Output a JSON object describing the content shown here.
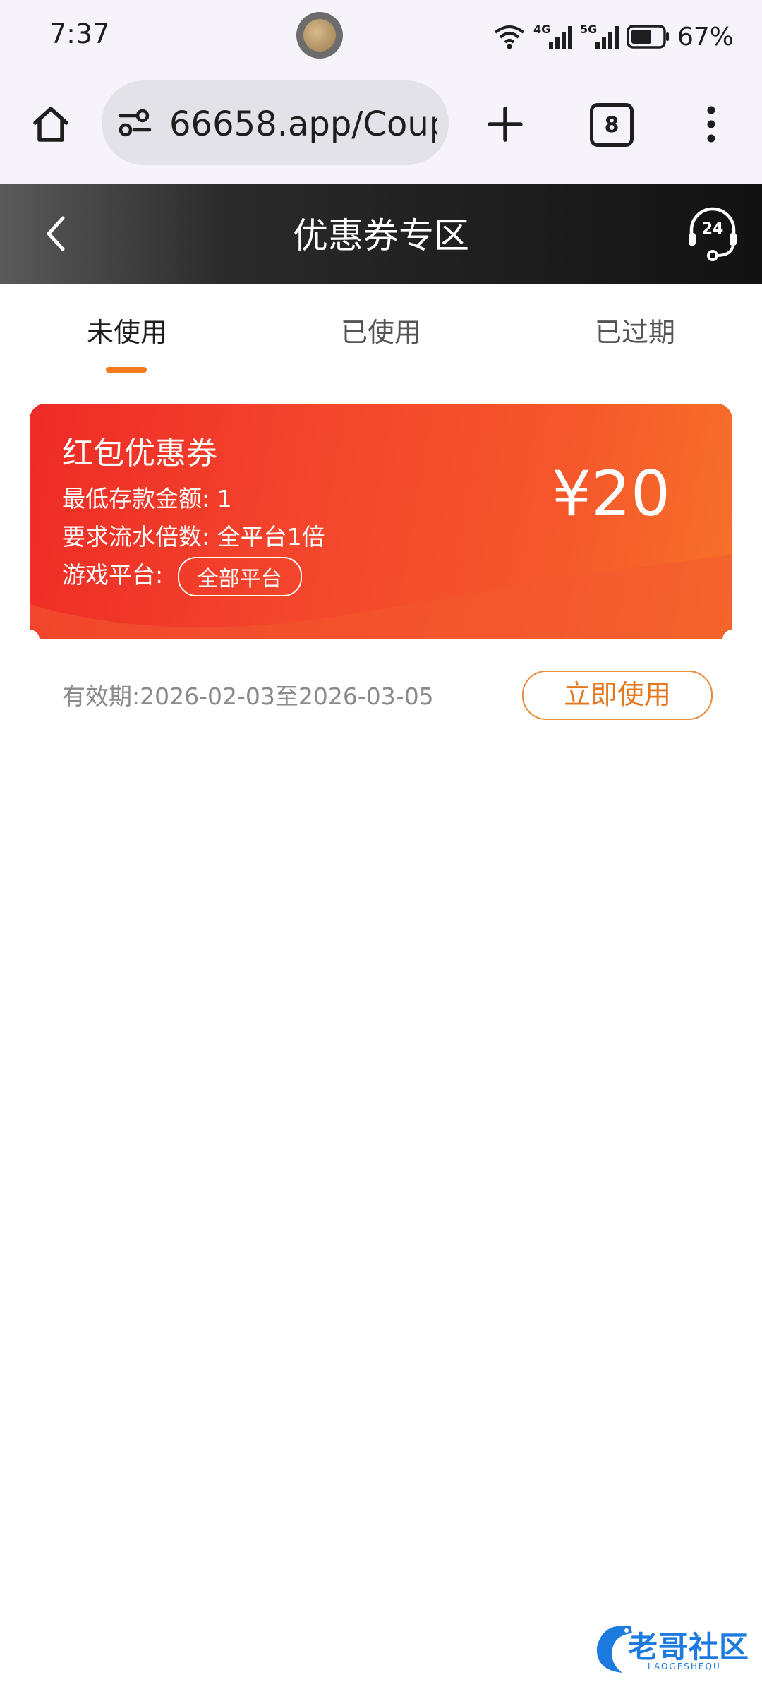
{
  "status_bar": {
    "time": "7:37",
    "network_4g": "4G",
    "network_5g": "5G",
    "battery": "67%",
    "battery_level": 0.67
  },
  "browser": {
    "url": "66658.app/Coup",
    "tab_count": "8"
  },
  "header": {
    "title": "优惠券专区",
    "support_badge": "24"
  },
  "tabs": [
    {
      "label": "未使用",
      "active": true
    },
    {
      "label": "已使用",
      "active": false
    },
    {
      "label": "已过期",
      "active": false
    }
  ],
  "coupon": {
    "title": "红包优惠券",
    "min_deposit": "最低存款金额: 1",
    "turnover": "要求流水倍数: 全平台1倍",
    "platform_label": "游戏平台:",
    "platform_tag": "全部平台",
    "amount": "¥20",
    "validity": "有效期:2026-02-03至2026-03-05",
    "use_button": "立即使用"
  },
  "watermark": {
    "text": "老哥社区",
    "subtext": "LAOGESHEQU"
  },
  "colors": {
    "accent": "#f47a1f",
    "coupon_red": "#ee2b26",
    "coupon_orange": "#f7722a",
    "header_dark": "#121212"
  }
}
